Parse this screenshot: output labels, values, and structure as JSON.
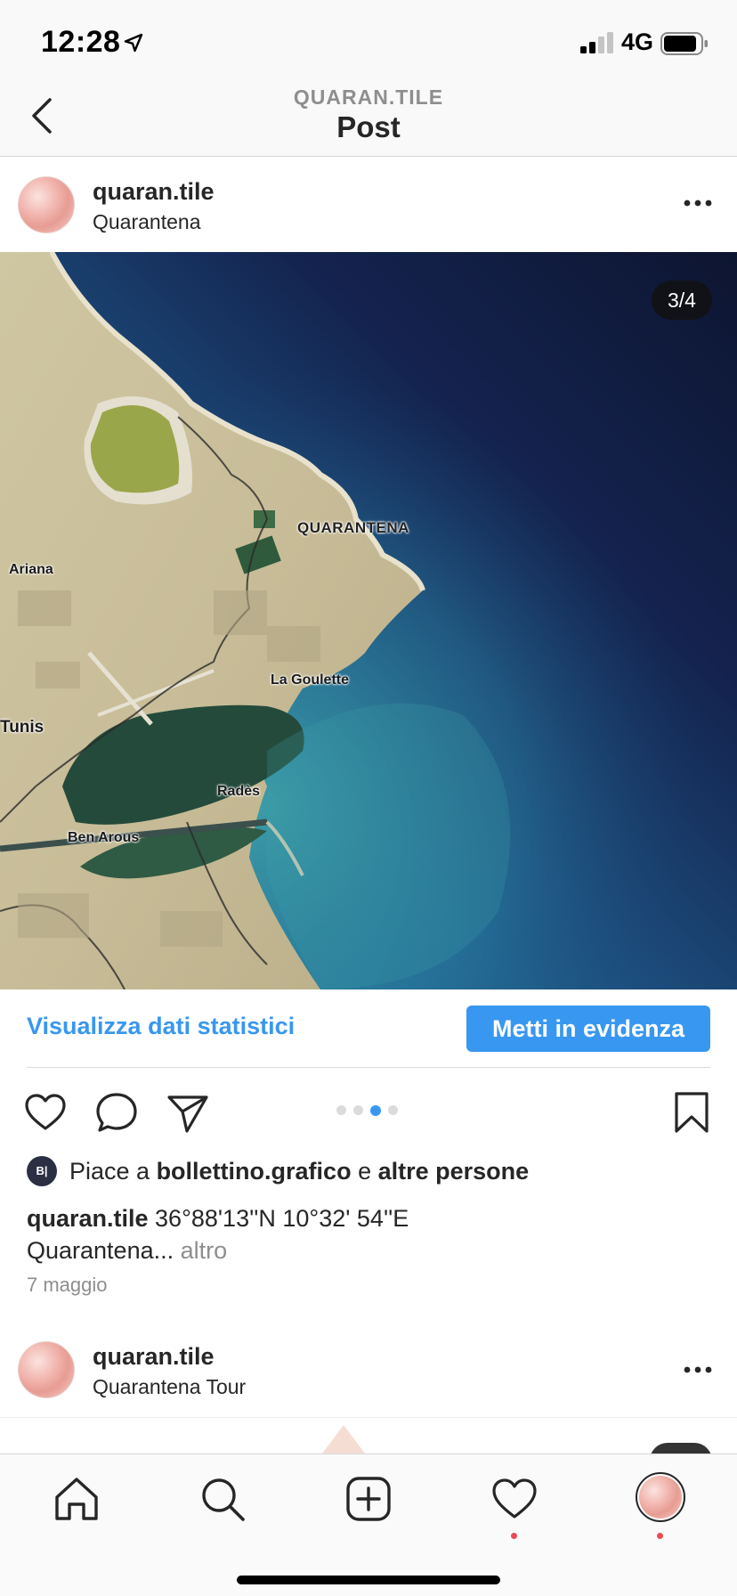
{
  "status_bar": {
    "time": "12:28",
    "network": "4G",
    "icons": [
      "location-arrow-icon",
      "signal-icon",
      "battery-icon"
    ]
  },
  "nav": {
    "subtitle": "QUARAN.TILE",
    "title": "Post",
    "back_icon": "chevron-left-icon"
  },
  "post": {
    "username": "quaran.tile",
    "location": "Quarantena",
    "image_counter": "3/4",
    "map_labels": {
      "main": "QUARANTENA",
      "ariana": "Ariana",
      "la_goulette": "La Goulette",
      "tunis": "Tunis",
      "rades": "Radès",
      "ben_arous": "Ben Arous"
    },
    "insights_link": "Visualizza dati statistici",
    "promote_button": "Metti in evidenza",
    "carousel": {
      "count": 4,
      "active_index": 2
    },
    "likes": {
      "avatar_text": "B|",
      "prefix": "Piace a ",
      "user": "bollettino.grafico",
      "middle": " e ",
      "others": "altre persone"
    },
    "caption": {
      "username": "quaran.tile",
      "text": " 36°88'13''N 10°32' 54''E",
      "text2": "Quarantena... ",
      "more": "altro"
    },
    "date": "7 maggio"
  },
  "next_post": {
    "username": "quaran.tile",
    "location": "Quarantena Tour"
  },
  "tab_bar": {
    "items": [
      "home-icon",
      "search-icon",
      "add-post-icon",
      "activity-heart-icon",
      "profile-avatar"
    ]
  },
  "colors": {
    "accent": "#3897f0",
    "notification": "#ed4956",
    "text": "#262626",
    "secondary": "#8e8e8e"
  }
}
